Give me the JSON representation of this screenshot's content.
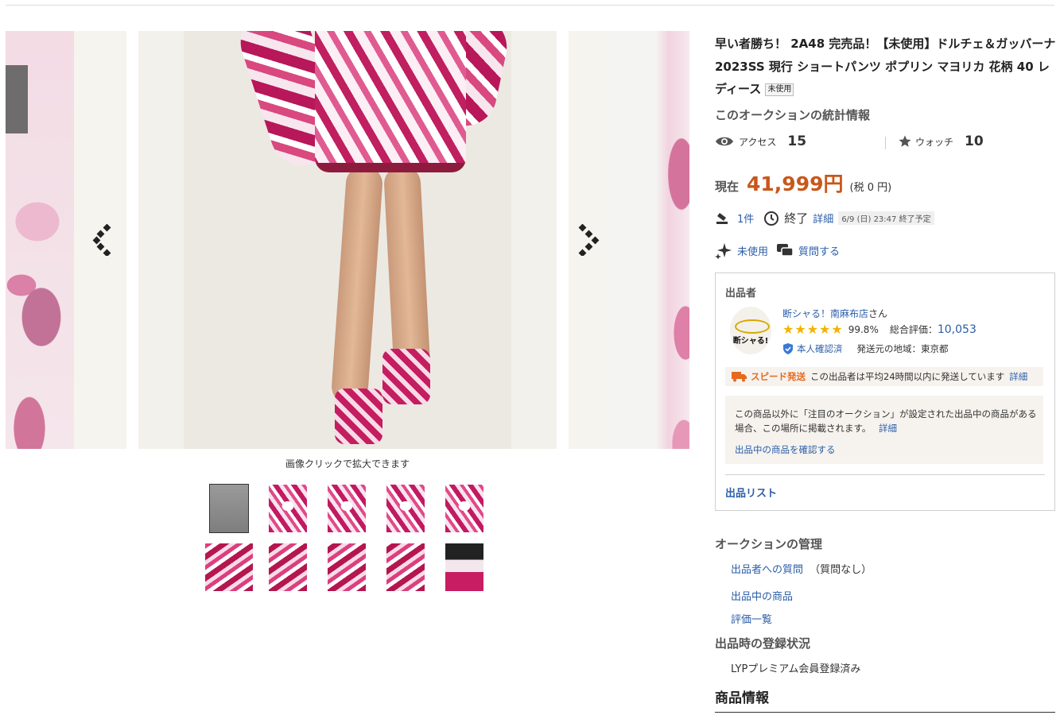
{
  "gallery": {
    "caption": "画像クリックで拡大できます"
  },
  "title": "早い者勝ち！ 2A48 完売品！【未使用】ドルチェ＆ガッバーナ 2023SS 現行 ショートパンツ ポプリン マヨリカ 花柄 40 レディース",
  "title_badge": "未使用",
  "stats": {
    "heading": "このオークションの統計情報",
    "access_label": "アクセス",
    "access_value": "15",
    "watch_label": "ウォッチ",
    "watch_value": "10"
  },
  "price": {
    "label": "現在",
    "value": "41,999円",
    "tax": "(税 0 円)"
  },
  "bids": {
    "count": "1件",
    "status": "終了",
    "detail": "詳細",
    "end_time": "6/9 (日) 23:47 終了予定"
  },
  "condition": {
    "label": "未使用",
    "question": "質問する"
  },
  "seller": {
    "heading": "出品者",
    "avatar_text": "断シャる!",
    "name": "断シャる！南麻布店",
    "suffix": "さん",
    "rating_percent": "99.8%",
    "total_label": "総合評価：",
    "total_value": "10,053",
    "verified": "本人確認済",
    "ship_from": "発送元の地域：東京都",
    "speed_title": "スピード発送",
    "speed_text": "この出品者は平均24時間以内に発送しています",
    "speed_detail": "詳細",
    "notice": "この商品以外に「注目のオークション」が設定された出品中の商品がある場合、この場所に掲載されます。",
    "notice_detail": "詳細",
    "notice_link": "出品中の商品を確認する",
    "list_link": "出品リスト"
  },
  "management": {
    "heading": "オークションの管理",
    "question_link": "出品者への質問",
    "question_note": "（質問なし）",
    "items_link": "出品中の商品",
    "reviews_link": "評価一覧"
  },
  "registration": {
    "heading": "出品時の登録状況",
    "value": "LYPプレミアム会員登録済み"
  },
  "product_info_heading": "商品情報"
}
